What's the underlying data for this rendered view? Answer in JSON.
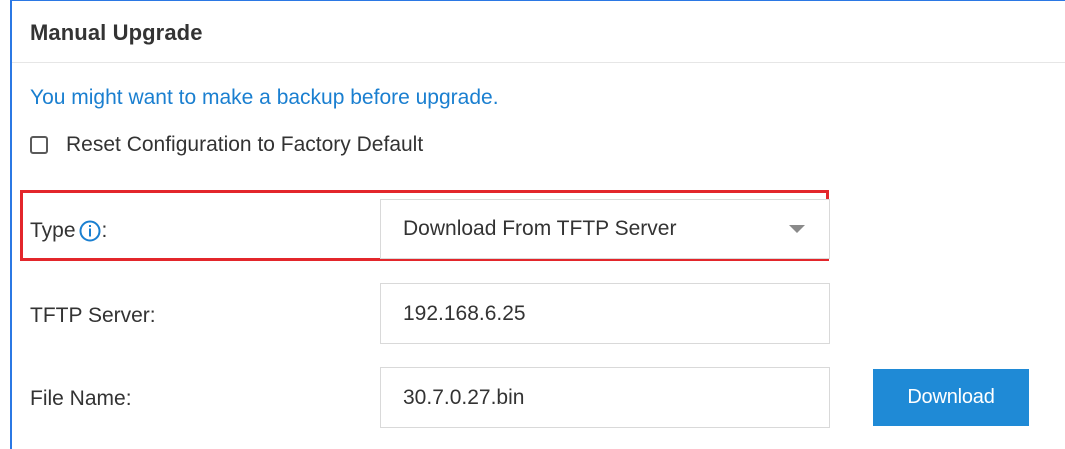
{
  "section": {
    "title": "Manual Upgrade"
  },
  "backup": {
    "link_text": "You might want to make a backup before upgrade."
  },
  "reset": {
    "label": "Reset Configuration to Factory Default",
    "checked": false
  },
  "type_field": {
    "label": "Type",
    "label_suffix": ":",
    "info_icon": "info-circle-icon",
    "selected_value": "Download From TFTP Server"
  },
  "tftp_server": {
    "label": "TFTP Server:",
    "value": "192.168.6.25"
  },
  "file_name": {
    "label": "File Name:",
    "value": "30.7.0.27.bin"
  },
  "download_button": {
    "label": "Download"
  },
  "colors": {
    "accent": "#1f8ad6",
    "link": "#1a7fd0",
    "highlight": "#e3262b",
    "frame_border": "#2b78e4"
  }
}
